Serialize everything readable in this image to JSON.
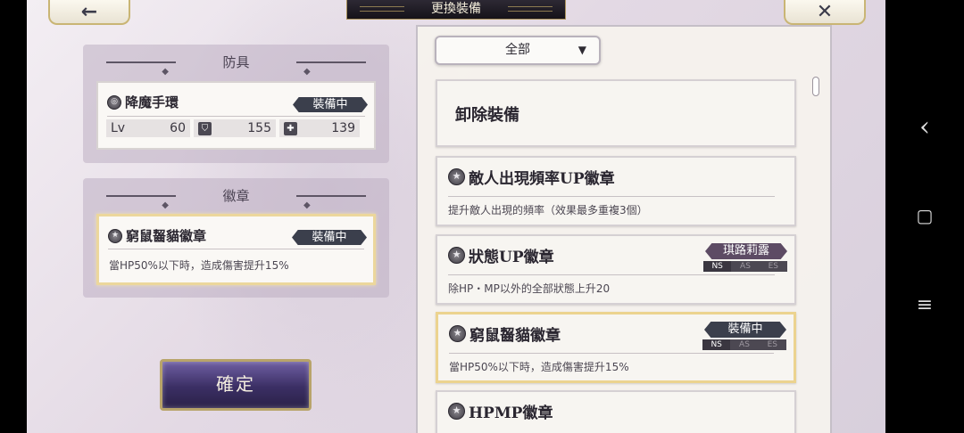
{
  "topbar": {
    "back_icon": "←",
    "close_icon": "✕",
    "title": "更換裝備"
  },
  "armor_panel": {
    "heading": "防具",
    "item": {
      "name": "降魔手環",
      "badge": "裝備中",
      "lv_label": "Lv",
      "lv": "60",
      "def": "155",
      "hp": "139"
    }
  },
  "badge_panel": {
    "heading": "徽章",
    "item": {
      "name": "窮鼠齧貓徽章",
      "badge": "裝備中",
      "desc": "當HP50%以下時，造成傷害提升15%"
    }
  },
  "confirm_label": "確定",
  "filter": {
    "selected": "全部",
    "arrow": "▼"
  },
  "list": [
    {
      "name": "卸除裝備"
    },
    {
      "name": "敵人出現頻率UP徽章",
      "desc": "提升敵人出現的頻率（效果最多重複3個）"
    },
    {
      "name": "狀態UP徽章",
      "desc": "除HP・MP以外的全部狀態上升20",
      "owner": "琪路莉露",
      "tags": [
        "NS",
        "AS",
        "ES"
      ]
    },
    {
      "name": "窮鼠齧貓徽章",
      "desc": "當HP50%以下時，造成傷害提升15%",
      "owner": "裝備中",
      "tags": [
        "NS",
        "AS",
        "ES"
      ]
    },
    {
      "name": "HPMP徽章"
    }
  ],
  "android_nav": {
    "back": "‹",
    "home": "▢",
    "menu": "≡"
  }
}
